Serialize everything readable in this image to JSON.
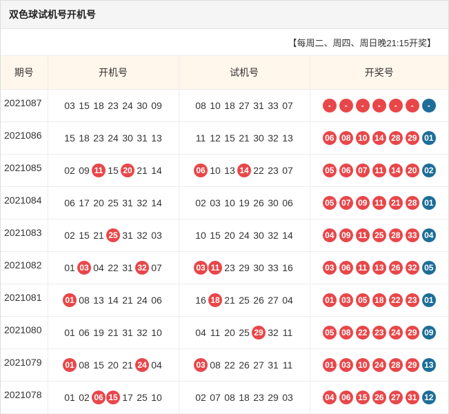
{
  "title": "双色球试机号开机号",
  "note": "【每周二、周四、周日晚21:15开奖】",
  "headers": {
    "issue": "期号",
    "open": "开机号",
    "test": "试机号",
    "draw": "开奖号"
  },
  "colors": {
    "red": "#e8474a",
    "blue": "#1d6e98",
    "header_bg": "#fff7ec"
  },
  "rows": [
    {
      "issue": "2021087",
      "open": [
        [
          "03",
          0
        ],
        [
          "15",
          0
        ],
        [
          "18",
          0
        ],
        [
          "23",
          0
        ],
        [
          "24",
          0
        ],
        [
          "30",
          0
        ],
        [
          "09",
          0
        ]
      ],
      "test": [
        [
          "08",
          0
        ],
        [
          "10",
          0
        ],
        [
          "18",
          0
        ],
        [
          "27",
          0
        ],
        [
          "31",
          0
        ],
        [
          "33",
          0
        ],
        [
          "07",
          0
        ]
      ],
      "red": [
        "-",
        "-",
        "-",
        "-",
        "-",
        "-"
      ],
      "blue": "-"
    },
    {
      "issue": "2021086",
      "open": [
        [
          "15",
          0
        ],
        [
          "18",
          0
        ],
        [
          "23",
          0
        ],
        [
          "24",
          0
        ],
        [
          "30",
          0
        ],
        [
          "31",
          0
        ],
        [
          "13",
          0
        ]
      ],
      "test": [
        [
          "11",
          0
        ],
        [
          "12",
          0
        ],
        [
          "15",
          0
        ],
        [
          "21",
          0
        ],
        [
          "30",
          0
        ],
        [
          "32",
          0
        ],
        [
          "13",
          0
        ]
      ],
      "red": [
        "06",
        "08",
        "10",
        "14",
        "28",
        "29"
      ],
      "blue": "01"
    },
    {
      "issue": "2021085",
      "open": [
        [
          "02",
          0
        ],
        [
          "09",
          0
        ],
        [
          "11",
          1
        ],
        [
          "15",
          0
        ],
        [
          "20",
          1
        ],
        [
          "21",
          0
        ],
        [
          "14",
          0
        ]
      ],
      "test": [
        [
          "06",
          1
        ],
        [
          "10",
          0
        ],
        [
          "13",
          0
        ],
        [
          "14",
          1
        ],
        [
          "22",
          0
        ],
        [
          "23",
          0
        ],
        [
          "07",
          0
        ]
      ],
      "red": [
        "05",
        "06",
        "07",
        "11",
        "14",
        "20"
      ],
      "blue": "02"
    },
    {
      "issue": "2021084",
      "open": [
        [
          "06",
          0
        ],
        [
          "17",
          0
        ],
        [
          "20",
          0
        ],
        [
          "25",
          0
        ],
        [
          "31",
          0
        ],
        [
          "32",
          0
        ],
        [
          "14",
          0
        ]
      ],
      "test": [
        [
          "02",
          0
        ],
        [
          "03",
          0
        ],
        [
          "10",
          0
        ],
        [
          "19",
          0
        ],
        [
          "26",
          0
        ],
        [
          "30",
          0
        ],
        [
          "06",
          0
        ]
      ],
      "red": [
        "05",
        "07",
        "09",
        "11",
        "21",
        "28"
      ],
      "blue": "01"
    },
    {
      "issue": "2021083",
      "open": [
        [
          "02",
          0
        ],
        [
          "15",
          0
        ],
        [
          "21",
          0
        ],
        [
          "25",
          1
        ],
        [
          "31",
          0
        ],
        [
          "32",
          0
        ],
        [
          "03",
          0
        ]
      ],
      "test": [
        [
          "10",
          0
        ],
        [
          "15",
          0
        ],
        [
          "20",
          0
        ],
        [
          "24",
          0
        ],
        [
          "30",
          0
        ],
        [
          "32",
          0
        ],
        [
          "14",
          0
        ]
      ],
      "red": [
        "04",
        "09",
        "11",
        "25",
        "28",
        "33"
      ],
      "blue": "04"
    },
    {
      "issue": "2021082",
      "open": [
        [
          "01",
          0
        ],
        [
          "03",
          1
        ],
        [
          "04",
          0
        ],
        [
          "22",
          0
        ],
        [
          "31",
          0
        ],
        [
          "32",
          1
        ],
        [
          "07",
          0
        ]
      ],
      "test": [
        [
          "03",
          1
        ],
        [
          "11",
          1
        ],
        [
          "23",
          0
        ],
        [
          "29",
          0
        ],
        [
          "30",
          0
        ],
        [
          "33",
          0
        ],
        [
          "16",
          0
        ]
      ],
      "red": [
        "03",
        "06",
        "11",
        "13",
        "26",
        "32"
      ],
      "blue": "05"
    },
    {
      "issue": "2021081",
      "open": [
        [
          "01",
          1
        ],
        [
          "08",
          0
        ],
        [
          "13",
          0
        ],
        [
          "14",
          0
        ],
        [
          "21",
          0
        ],
        [
          "24",
          0
        ],
        [
          "06",
          0
        ]
      ],
      "test": [
        [
          "16",
          0
        ],
        [
          "18",
          1
        ],
        [
          "21",
          0
        ],
        [
          "25",
          0
        ],
        [
          "26",
          0
        ],
        [
          "27",
          0
        ],
        [
          "04",
          0
        ]
      ],
      "red": [
        "01",
        "03",
        "05",
        "18",
        "22",
        "23"
      ],
      "blue": "01"
    },
    {
      "issue": "2021080",
      "open": [
        [
          "01",
          0
        ],
        [
          "06",
          0
        ],
        [
          "19",
          0
        ],
        [
          "21",
          0
        ],
        [
          "31",
          0
        ],
        [
          "32",
          0
        ],
        [
          "10",
          0
        ]
      ],
      "test": [
        [
          "04",
          0
        ],
        [
          "11",
          0
        ],
        [
          "20",
          0
        ],
        [
          "25",
          0
        ],
        [
          "29",
          1
        ],
        [
          "32",
          0
        ],
        [
          "11",
          0
        ]
      ],
      "red": [
        "05",
        "08",
        "22",
        "23",
        "24",
        "29"
      ],
      "blue": "09"
    },
    {
      "issue": "2021079",
      "open": [
        [
          "01",
          1
        ],
        [
          "08",
          0
        ],
        [
          "15",
          0
        ],
        [
          "20",
          0
        ],
        [
          "21",
          0
        ],
        [
          "24",
          1
        ],
        [
          "04",
          0
        ]
      ],
      "test": [
        [
          "03",
          1
        ],
        [
          "08",
          0
        ],
        [
          "22",
          0
        ],
        [
          "26",
          0
        ],
        [
          "27",
          0
        ],
        [
          "31",
          0
        ],
        [
          "11",
          0
        ]
      ],
      "red": [
        "01",
        "03",
        "10",
        "24",
        "28",
        "29"
      ],
      "blue": "13"
    },
    {
      "issue": "2021078",
      "open": [
        [
          "01",
          0
        ],
        [
          "02",
          0
        ],
        [
          "06",
          1
        ],
        [
          "15",
          1
        ],
        [
          "17",
          0
        ],
        [
          "25",
          0
        ],
        [
          "10",
          0
        ]
      ],
      "test": [
        [
          "02",
          0
        ],
        [
          "07",
          0
        ],
        [
          "08",
          0
        ],
        [
          "18",
          0
        ],
        [
          "23",
          0
        ],
        [
          "29",
          0
        ],
        [
          "03",
          0
        ]
      ],
      "red": [
        "04",
        "06",
        "15",
        "26",
        "27",
        "31"
      ],
      "blue": "12"
    }
  ]
}
